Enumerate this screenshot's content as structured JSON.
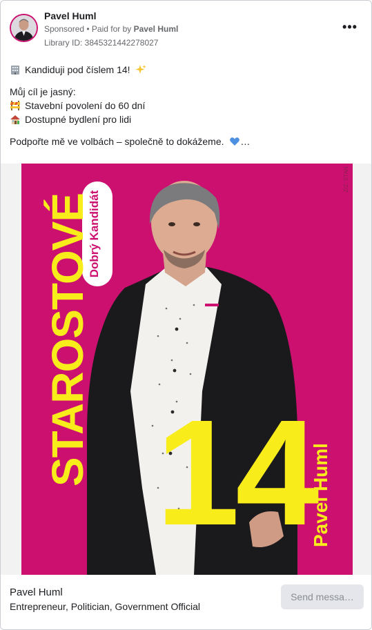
{
  "header": {
    "page_name": "Pavel Huml",
    "sponsored": "Sponsored",
    "paid_for_prefix": " • Paid for by ",
    "paid_for_name": "Pavel Huml",
    "library_id": "Library ID: 3845321442278027",
    "more_label": "•••"
  },
  "post": {
    "line1": "Kandiduji pod číslem 14!",
    "line2": "Můj cíl je jasný:",
    "line3": "Stavební povolení do 60 dní",
    "line4": "Dostupné bydlení pro lidi",
    "line5": "Podpořte mě ve volbách – společně to dokážeme.",
    "ellipsis": "…",
    "icons": [
      "office-building-emoji",
      "sparkles-emoji",
      "construction-emoji",
      "house-emoji",
      "blue-heart-emoji"
    ]
  },
  "creative": {
    "party": "STAROSTOVÉ",
    "tagline": "Dobrý Kandidát",
    "number": "14",
    "candidate": "Pavel Huml",
    "credit": "Z/Z: STAN",
    "colors": {
      "background": "#cc1070",
      "accent": "#f9ec1b"
    }
  },
  "footer": {
    "name": "Pavel Huml",
    "subtitle": "Entrepreneur, Politician, Government Official",
    "cta_label": "Send messa…"
  }
}
